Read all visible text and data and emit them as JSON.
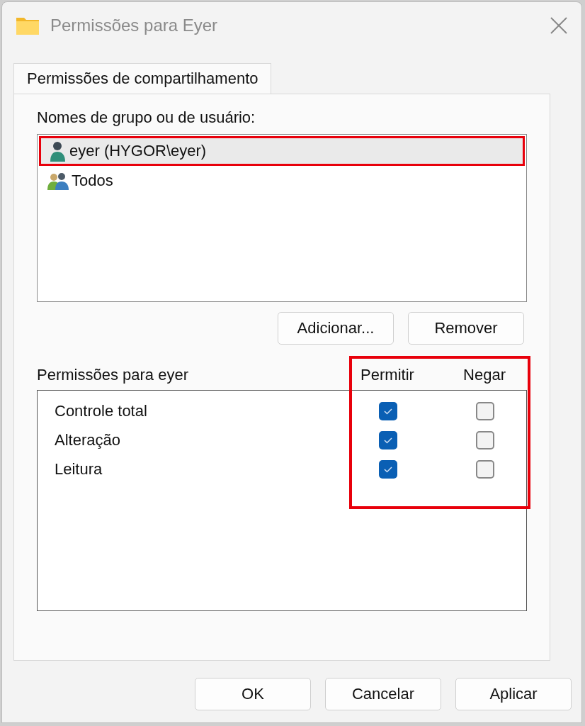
{
  "window": {
    "title": "Permissões para Eyer"
  },
  "tabs": [
    {
      "label": "Permissões de compartilhamento",
      "selected": true
    }
  ],
  "users": {
    "label": "Nomes de grupo ou de usuário:",
    "items": [
      {
        "name": "eyer (HYGOR\\eyer)",
        "kind": "user",
        "selected": true,
        "highlighted": true
      },
      {
        "name": "Todos",
        "kind": "group",
        "selected": false,
        "highlighted": false
      }
    ]
  },
  "user_buttons": [
    "Adicionar...",
    "Remover"
  ],
  "permissions": {
    "label": "Permissões para eyer",
    "columns": [
      "Permitir",
      "Negar"
    ],
    "columns_highlighted": true,
    "rows": [
      {
        "name": "Controle total",
        "allow": true,
        "deny": false
      },
      {
        "name": "Alteração",
        "allow": true,
        "deny": false
      },
      {
        "name": "Leitura",
        "allow": true,
        "deny": false
      }
    ]
  },
  "buttons": [
    "OK",
    "Cancelar",
    "Aplicar"
  ]
}
